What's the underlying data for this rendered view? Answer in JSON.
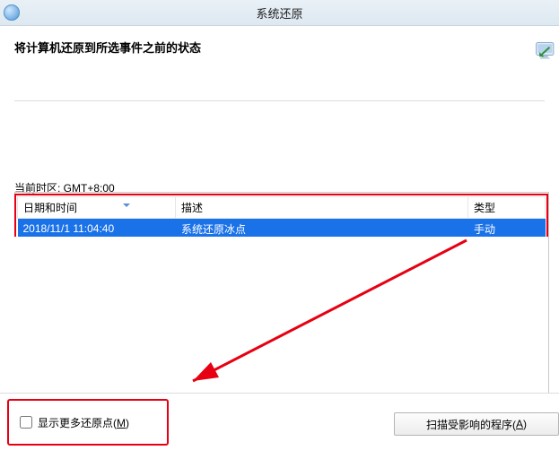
{
  "window": {
    "title": "系统还原"
  },
  "heading": "将计算机还原到所选事件之前的状态",
  "timezone_label": "当前时区: GMT+8:00",
  "table": {
    "headers": {
      "datetime": "日期和时间",
      "description": "描述",
      "type": "类型"
    },
    "rows": [
      {
        "datetime": "2018/11/1 11:04:40",
        "description": "系统还原冰点",
        "type": "手动"
      }
    ]
  },
  "checkbox": {
    "label_prefix": "显示更多还原点(",
    "accel": "M",
    "label_suffix": ")"
  },
  "scan_button": {
    "label_prefix": "扫描受影响的程序(",
    "accel": "A",
    "label_suffix": ")"
  },
  "icons": {
    "app": "system-restore-icon",
    "monitor": "monitor-arrow-icon"
  },
  "colors": {
    "highlight_row": "#1a72e8",
    "annotation": "#e60012"
  }
}
